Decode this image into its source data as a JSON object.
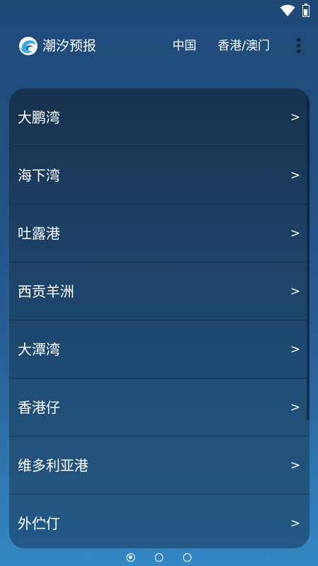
{
  "app": {
    "title": "潮汐预报"
  },
  "nav": {
    "tabs": [
      {
        "label": "中国"
      },
      {
        "label": "香港/澳门"
      }
    ]
  },
  "locations": [
    {
      "label": "大鹏湾",
      "chevron": ">"
    },
    {
      "label": "海下湾",
      "chevron": ">"
    },
    {
      "label": "吐露港",
      "chevron": ">"
    },
    {
      "label": "西贡羊洲",
      "chevron": ">"
    },
    {
      "label": "大潭湾",
      "chevron": ">"
    },
    {
      "label": "香港仔",
      "chevron": ">"
    },
    {
      "label": "维多利亚港",
      "chevron": ">"
    },
    {
      "label": "外伫仃",
      "chevron": ">"
    }
  ],
  "pager": {
    "pages": 3,
    "active_page": 1
  },
  "colors": {
    "background_top": "#1f4a78",
    "background_bottom": "#3488c4",
    "card": "#1d4266",
    "logo_accent": "#3fa9e6"
  }
}
